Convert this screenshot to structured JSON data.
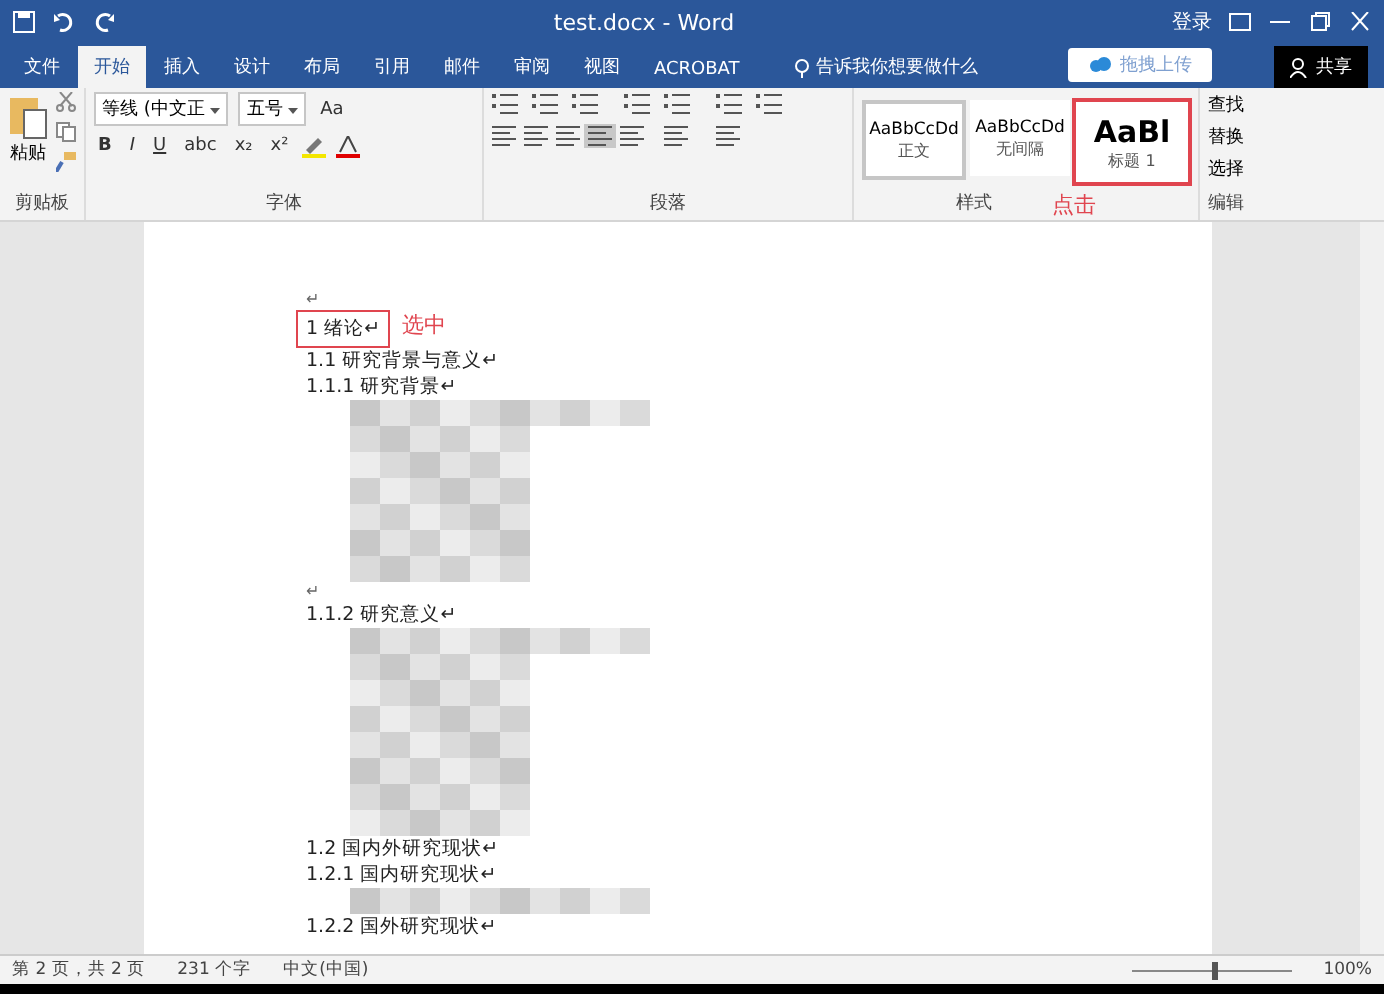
{
  "title_bar": {
    "title": "test.docx - Word",
    "sign_in": "登录",
    "upload_button": "拖拽上传",
    "share_button": "共享"
  },
  "tabs": [
    {
      "label": "文件",
      "selected": false
    },
    {
      "label": "开始",
      "selected": true
    },
    {
      "label": "插入",
      "selected": false
    },
    {
      "label": "设计",
      "selected": false
    },
    {
      "label": "布局",
      "selected": false
    },
    {
      "label": "引用",
      "selected": false
    },
    {
      "label": "邮件",
      "selected": false
    },
    {
      "label": "审阅",
      "selected": false
    },
    {
      "label": "视图",
      "selected": false
    },
    {
      "label": "ACROBAT",
      "selected": false
    }
  ],
  "tell_me": "告诉我你想要做什么",
  "ribbon": {
    "clipboard": {
      "paste": "粘贴",
      "label": "剪贴板"
    },
    "font": {
      "font_name": "等线 (中文正",
      "font_size": "五号",
      "case_button": "Aa",
      "format_buttons": [
        "B",
        "I",
        "U",
        "abc",
        "x₂",
        "x²"
      ],
      "label": "字体"
    },
    "paragraph": {
      "label": "段落"
    },
    "styles": {
      "items": [
        {
          "preview": "AaBbCcDd",
          "name": "正文",
          "selected": true,
          "kind": "normal"
        },
        {
          "preview": "AaBbCcDd",
          "name": "无间隔",
          "selected": false,
          "kind": "normal"
        },
        {
          "preview": "AaBl",
          "name": "标题 1",
          "selected": false,
          "kind": "heading"
        }
      ],
      "label": "样式"
    },
    "editing": {
      "items": [
        "查找",
        "替换",
        "选择"
      ],
      "label": "编辑"
    }
  },
  "annotations": [
    {
      "text": "选中"
    },
    {
      "text": "点击"
    }
  ],
  "document": [
    {
      "kind": "mark",
      "text": "↵"
    },
    {
      "kind": "line",
      "text": "1 绪论↵",
      "boxed": true
    },
    {
      "kind": "line",
      "text": "1.1 研究背景与意义↵"
    },
    {
      "kind": "line",
      "text": "1.1.1 研究背景↵"
    },
    {
      "kind": "blur"
    },
    {
      "kind": "mark",
      "text": "↵"
    },
    {
      "kind": "line",
      "text": "1.1.2 研究意义↵"
    },
    {
      "kind": "blur"
    },
    {
      "kind": "line",
      "text": "1.2 国内外研究现状↵"
    },
    {
      "kind": "line",
      "text": "1.2.1 国内研究现状↵"
    },
    {
      "kind": "blur"
    },
    {
      "kind": "line",
      "text": "1.2.2 国外研究现状↵"
    }
  ],
  "status_bar": {
    "page": "第 2 页，共 2 页",
    "words": "231 个字",
    "language": "中文(中国)",
    "zoom": "100%",
    "zoom_slider": {
      "level": 0.5
    }
  }
}
